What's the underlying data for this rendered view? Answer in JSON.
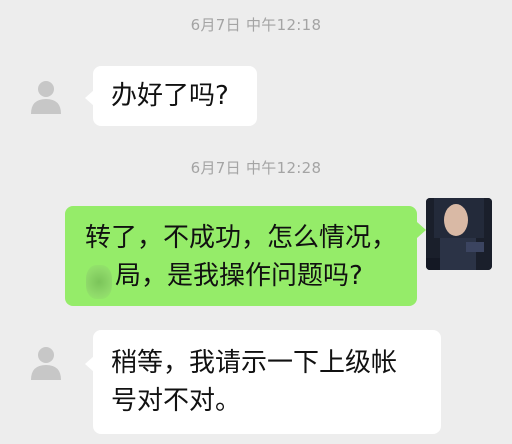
{
  "timestamps": [
    "6月7日 中午12:18",
    "6月7日 中午12:28"
  ],
  "messages": [
    {
      "sender": "other",
      "lines": [
        "办好了吗?"
      ]
    },
    {
      "sender": "self",
      "lines": [
        "转了，不成功，怎么情况，",
        "局，是我操作问题吗?"
      ]
    },
    {
      "sender": "other",
      "lines": [
        "稍等，我请示一下上级帐",
        "号对不对。"
      ]
    }
  ],
  "colors": {
    "background": "#ededed",
    "bubble_self": "#95ec69",
    "bubble_other": "#ffffff",
    "timestamp_text": "#a4a4a4"
  },
  "icons": {
    "default_avatar": "person-silhouette-icon",
    "user_avatar": "blurred-photo-avatar"
  }
}
